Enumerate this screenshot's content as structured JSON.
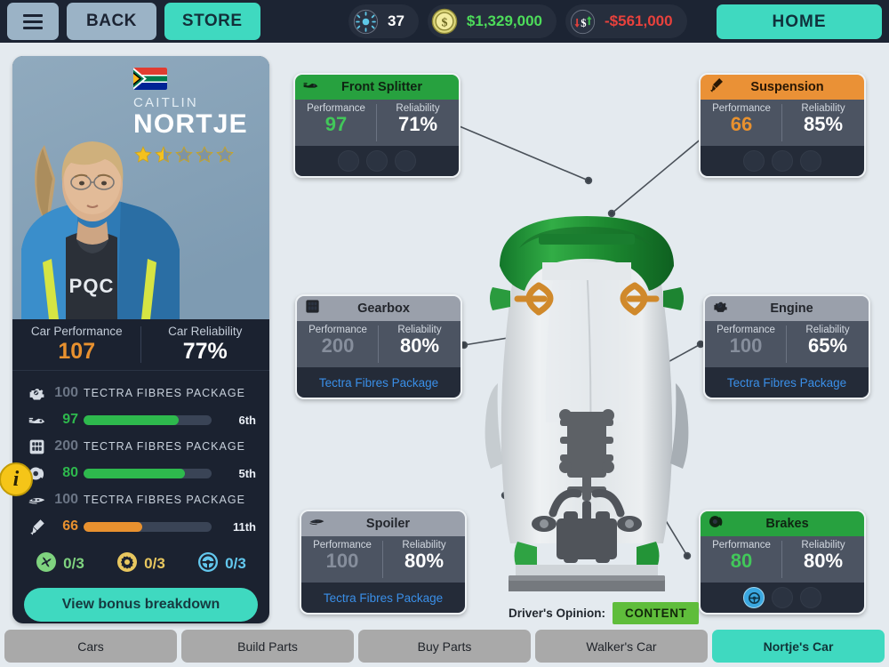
{
  "topbar": {
    "menu_icon": "hamburger-icon",
    "back_label": "BACK",
    "store_label": "STORE",
    "home_label": "HOME",
    "resources": [
      {
        "icon": "token-icon",
        "value": "37",
        "color": "#ffffff"
      },
      {
        "icon": "coin-icon",
        "value": "$1,329,000",
        "color": "#4ddc5a"
      },
      {
        "icon": "cashflow-icon",
        "value": "-$561,000",
        "color": "#e8413c"
      }
    ]
  },
  "driver": {
    "flag": "south-africa-flag",
    "first_name": "CAITLIN",
    "last_name": "NORTJE",
    "rating": 1.5,
    "rating_max": 5,
    "car_performance_label": "Car Performance",
    "car_performance_value": "107",
    "car_reliability_label": "Car Reliability",
    "car_reliability_value": "77%",
    "stats": [
      {
        "icon": "engine-icon",
        "value": "100",
        "type": "package",
        "package": "TECTRA FIBRES PACKAGE"
      },
      {
        "icon": "splitter-icon",
        "value": "97",
        "type": "bar",
        "pct": 74,
        "bar_color": "#2eb94d",
        "rank": "6th"
      },
      {
        "icon": "gearbox-icon",
        "value": "200",
        "type": "package",
        "package": "TECTRA FIBRES PACKAGE"
      },
      {
        "icon": "brakes-icon",
        "value": "80",
        "type": "bar",
        "pct": 79,
        "bar_color": "#2eb94d",
        "rank": "5th"
      },
      {
        "icon": "spoiler-icon",
        "value": "100",
        "type": "package",
        "package": "TECTRA FIBRES PACKAGE"
      },
      {
        "icon": "suspension-icon",
        "value": "66",
        "type": "bar",
        "pct": 46,
        "bar_color": "#e8912f",
        "rank": "11th"
      }
    ],
    "bonuses": [
      {
        "icon": "aero-bonus-icon",
        "text": "0/3",
        "color": "#7fd37f"
      },
      {
        "icon": "mech-bonus-icon",
        "text": "0/3",
        "color": "#e8c75f"
      },
      {
        "icon": "driving-bonus-icon",
        "text": "0/3",
        "color": "#63c8ee"
      }
    ],
    "info_badge": "i",
    "bonus_button": "View bonus breakdown"
  },
  "cards": [
    {
      "id": "front-splitter",
      "title": "Front Splitter",
      "icon": "splitter-icon",
      "header_style": "green",
      "performance_label": "Performance",
      "performance_value": "97",
      "performance_color": "green",
      "reliability_label": "Reliability",
      "reliability_value": "71%",
      "foot_type": "slots",
      "slots": [
        false,
        false,
        false
      ]
    },
    {
      "id": "suspension",
      "title": "Suspension",
      "icon": "suspension-icon",
      "header_style": "orange",
      "performance_label": "Performance",
      "performance_value": "66",
      "performance_color": "orange",
      "reliability_label": "Reliability",
      "reliability_value": "85%",
      "foot_type": "slots",
      "slots": [
        false,
        false,
        false
      ]
    },
    {
      "id": "gearbox",
      "title": "Gearbox",
      "icon": "gearbox-icon",
      "header_style": "grey",
      "performance_label": "Performance",
      "performance_value": "200",
      "performance_color": "dim",
      "reliability_label": "Reliability",
      "reliability_value": "80%",
      "foot_type": "link",
      "link_text": "Tectra Fibres Package"
    },
    {
      "id": "engine",
      "title": "Engine",
      "icon": "engine-icon",
      "header_style": "grey",
      "performance_label": "Performance",
      "performance_value": "100",
      "performance_color": "dim",
      "reliability_label": "Reliability",
      "reliability_value": "65%",
      "foot_type": "link",
      "link_text": "Tectra Fibres Package"
    },
    {
      "id": "spoiler",
      "title": "Spoiler",
      "icon": "spoiler-icon",
      "header_style": "grey",
      "performance_label": "Performance",
      "performance_value": "100",
      "performance_color": "dim",
      "reliability_label": "Reliability",
      "reliability_value": "80%",
      "foot_type": "link",
      "link_text": "Tectra Fibres Package"
    },
    {
      "id": "brakes",
      "title": "Brakes",
      "icon": "brakes-icon",
      "header_style": "green",
      "performance_label": "Performance",
      "performance_value": "80",
      "performance_color": "green",
      "reliability_label": "Reliability",
      "reliability_value": "80%",
      "foot_type": "slots",
      "slots": [
        true,
        false,
        false
      ]
    }
  ],
  "opinion": {
    "label": "Driver's Opinion:",
    "value": "CONTENT",
    "color": "#5fbd3b"
  },
  "tabs": [
    {
      "label": "Cars",
      "active": false
    },
    {
      "label": "Build Parts",
      "active": false
    },
    {
      "label": "Buy Parts",
      "active": false
    },
    {
      "label": "Walker's Car",
      "active": false
    },
    {
      "label": "Nortje's Car",
      "active": true
    }
  ],
  "theme": {
    "accent": "#3fd9c0",
    "background": "#e4eaef",
    "panel": "#1b2230",
    "green": "#27a13f",
    "orange": "#ea9136"
  }
}
